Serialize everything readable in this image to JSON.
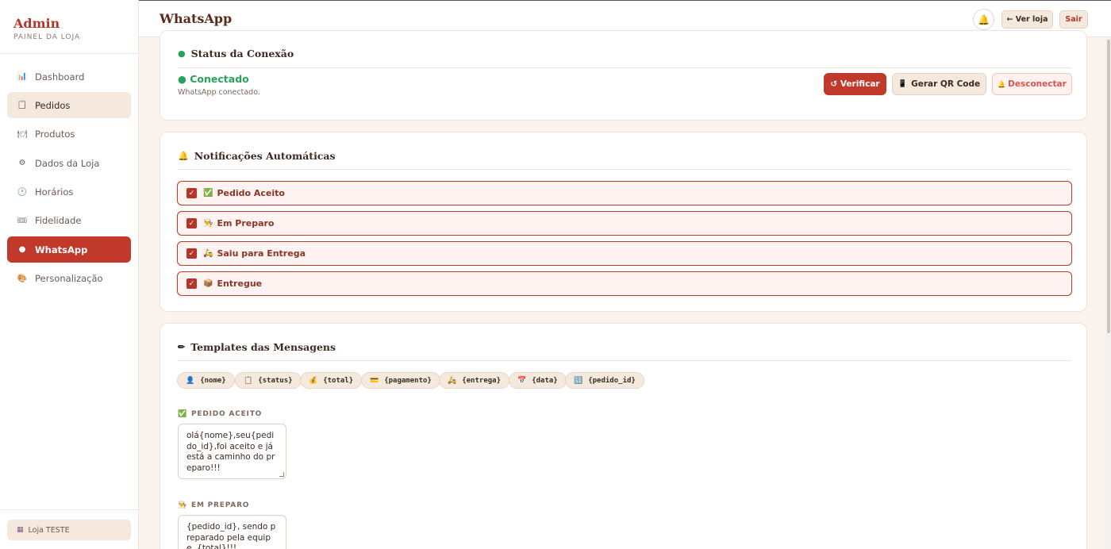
{
  "sidebar": {
    "brand_title": "Admin",
    "brand_sub": "PAINEL DA LOJA",
    "items": [
      {
        "label": "Dashboard",
        "icon": "📊"
      },
      {
        "label": "Pedidos",
        "icon": "📋"
      },
      {
        "label": "Produtos",
        "icon": "🍽"
      },
      {
        "label": "Dados da Loja",
        "icon": "⚙"
      },
      {
        "label": "Horários",
        "icon": "🕐"
      },
      {
        "label": "Fidelidade",
        "icon": "🎟"
      },
      {
        "label": "WhatsApp",
        "icon": "●"
      },
      {
        "label": "Personalização",
        "icon": "🎨"
      }
    ],
    "footer_store": "Loja TESTE"
  },
  "header": {
    "title": "WhatsApp",
    "bell_icon": "🔔",
    "ver_loja_label": "← Ver loja",
    "sair_label": "Sair"
  },
  "status_card": {
    "title": "Status da Conexão",
    "status": "● Conectado",
    "description": "WhatsApp conectado.",
    "verify_label": "↺ Verificar",
    "qr_label": "Gerar QR Code",
    "qr_icon": "📱",
    "disconnect_label": "Desconectar",
    "disconnect_icon": "🔔"
  },
  "notifications_card": {
    "title": "Notificações Automáticas",
    "title_icon": "🔔",
    "items": [
      {
        "label": "Pedido Aceito",
        "icon": "✅",
        "checked": true
      },
      {
        "label": "Em Preparo",
        "icon": "👨‍🍳",
        "checked": true
      },
      {
        "label": "Saiu para Entrega",
        "icon": "🛵",
        "checked": true
      },
      {
        "label": "Entregue",
        "icon": "📦",
        "checked": true
      }
    ]
  },
  "templates_card": {
    "title": "Templates das Mensagens",
    "title_icon": "✏",
    "variables": [
      {
        "label": "{nome}",
        "icon": "👤"
      },
      {
        "label": "{status}",
        "icon": "📋"
      },
      {
        "label": "{total}",
        "icon": "💰"
      },
      {
        "label": "{pagamento}",
        "icon": "💳"
      },
      {
        "label": "{entrega}",
        "icon": "🛵"
      },
      {
        "label": "{data}",
        "icon": "📅"
      },
      {
        "label": "{pedido_id}",
        "icon": "🔢"
      }
    ],
    "templates": [
      {
        "label": "PEDIDO ACEITO",
        "icon": "✅",
        "text": "olá{nome},seu{pedido_id},foi aceito e já está a caminho do preparo!!!"
      },
      {
        "label": "EM PREPARO",
        "icon": "👨‍🍳",
        "text": "{pedido_id}, sendo preparado pela equipe, {total}!!!"
      }
    ]
  },
  "colors": {
    "accent": "#c0392b",
    "success": "#27a35a",
    "chip_bg": "#f5e8dc"
  }
}
